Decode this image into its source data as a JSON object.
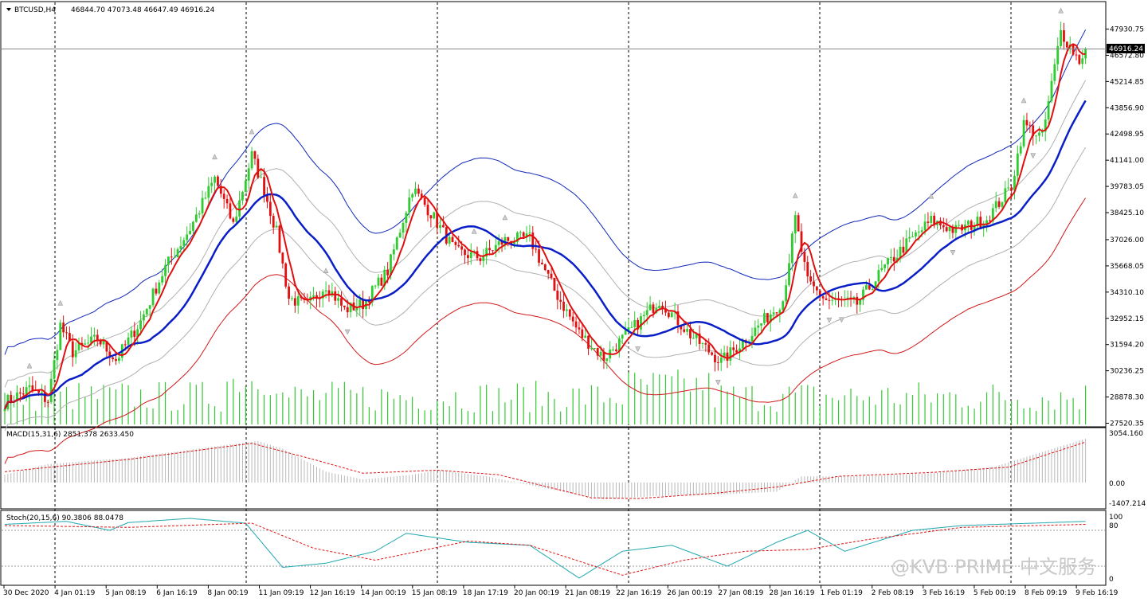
{
  "header": {
    "symbol": "BTCUSD,H4",
    "ohlc": "46844.70 47073.48 46647.49 46916.24"
  },
  "price_scale": {
    "ticks": [
      "47930.75",
      "46572.80",
      "45214.85",
      "43856.90",
      "42498.95",
      "41141.00",
      "39783.05",
      "38425.10",
      "37026.00",
      "35668.05",
      "34310.10",
      "32952.15",
      "31594.20",
      "30236.25",
      "28878.30",
      "27520.35"
    ],
    "current_price": "46916.24"
  },
  "macd": {
    "label": "MACD(15,31,6) 2851.378 2633.450",
    "ticks": [
      "3054.160",
      "0.00",
      "-1407.214"
    ]
  },
  "stoch": {
    "label": "Stoch(20,15,6) 90.3806 88.0478",
    "ticks": [
      "100",
      "80",
      "0"
    ]
  },
  "time_axis": [
    "30 Dec 2020",
    "4 Jan 01:19",
    "5 Jan 08:19",
    "6 Jan 16:19",
    "8 Jan 00:19",
    "11 Jan 09:19",
    "12 Jan 16:19",
    "14 Jan 00:19",
    "15 Jan 08:19",
    "18 Jan 17:19",
    "20 Jan 00:19",
    "21 Jan 08:19",
    "22 Jan 16:19",
    "26 Jan 00:19",
    "27 Jan 08:19",
    "28 Jan 16:19",
    "1 Feb 01:19",
    "2 Feb 08:19",
    "3 Feb 16:19",
    "5 Feb 00:19",
    "8 Feb 09:19",
    "9 Feb 16:19"
  ],
  "watermark": "@KVB PRIME 中文服务",
  "colors": {
    "bull": "#2ecc2e",
    "bear": "#e01010",
    "ema_fast": "#e01010",
    "ema_slow": "#0a1ec8",
    "env_upper": "#1028b8",
    "env_lower": "#d01818",
    "env_inner": "#b0b0b0",
    "volume": "#34c834",
    "stoch_main": "#20a8b0",
    "stoch_signal": "#e01010"
  },
  "chart_data": [
    {
      "type": "candlestick",
      "title": "BTCUSD,H4",
      "ylim": [
        27520.35,
        48800
      ],
      "anchors": [
        [
          0,
          28600
        ],
        [
          8,
          29300
        ],
        [
          14,
          28700
        ],
        [
          18,
          32600
        ],
        [
          22,
          31200
        ],
        [
          30,
          31900
        ],
        [
          36,
          30800
        ],
        [
          44,
          32800
        ],
        [
          52,
          35600
        ],
        [
          60,
          37600
        ],
        [
          68,
          40200
        ],
        [
          74,
          37800
        ],
        [
          80,
          41400
        ],
        [
          84,
          39600
        ],
        [
          88,
          37400
        ],
        [
          92,
          34000
        ],
        [
          98,
          33600
        ],
        [
          104,
          34700
        ],
        [
          110,
          33400
        ],
        [
          116,
          33700
        ],
        [
          124,
          35400
        ],
        [
          132,
          39700
        ],
        [
          138,
          38400
        ],
        [
          146,
          36400
        ],
        [
          154,
          36100
        ],
        [
          162,
          37000
        ],
        [
          170,
          37100
        ],
        [
          178,
          34400
        ],
        [
          186,
          32200
        ],
        [
          194,
          30900
        ],
        [
          202,
          32200
        ],
        [
          212,
          33900
        ],
        [
          222,
          32100
        ],
        [
          232,
          30700
        ],
        [
          242,
          32200
        ],
        [
          252,
          33900
        ],
        [
          256,
          38100
        ],
        [
          260,
          34800
        ],
        [
          266,
          33900
        ],
        [
          276,
          33700
        ],
        [
          284,
          35400
        ],
        [
          292,
          36800
        ],
        [
          300,
          38000
        ],
        [
          308,
          37500
        ],
        [
          318,
          38100
        ],
        [
          326,
          39800
        ],
        [
          330,
          43000
        ],
        [
          336,
          42300
        ],
        [
          342,
          47800
        ],
        [
          348,
          46300
        ],
        [
          350,
          46916
        ]
      ]
    },
    {
      "type": "bar",
      "title": "MACD(15,31,6) 2851.378 2633.450",
      "ylim": [
        -1407.214,
        3054.16
      ],
      "anchors": [
        [
          0,
          500
        ],
        [
          14,
          1200
        ],
        [
          40,
          1600
        ],
        [
          70,
          2400
        ],
        [
          82,
          2700
        ],
        [
          90,
          2200
        ],
        [
          104,
          700
        ],
        [
          116,
          200
        ],
        [
          132,
          500
        ],
        [
          140,
          800
        ],
        [
          156,
          400
        ],
        [
          178,
          -500
        ],
        [
          194,
          -1100
        ],
        [
          210,
          -900
        ],
        [
          230,
          -800
        ],
        [
          250,
          -600
        ],
        [
          258,
          400
        ],
        [
          276,
          400
        ],
        [
          300,
          600
        ],
        [
          320,
          1000
        ],
        [
          350,
          2851
        ]
      ],
      "signal_anchors": [
        [
          0,
          700
        ],
        [
          40,
          1500
        ],
        [
          80,
          2550
        ],
        [
          100,
          1500
        ],
        [
          116,
          600
        ],
        [
          140,
          800
        ],
        [
          160,
          500
        ],
        [
          190,
          -1000
        ],
        [
          205,
          -1050
        ],
        [
          230,
          -700
        ],
        [
          250,
          -300
        ],
        [
          270,
          400
        ],
        [
          300,
          650
        ],
        [
          325,
          1000
        ],
        [
          350,
          2633
        ]
      ]
    },
    {
      "type": "line",
      "title": "Stoch(20,15,6) 90.3806 88.0478",
      "ylim": [
        0,
        100
      ],
      "main_anchors": [
        [
          0,
          90
        ],
        [
          20,
          95
        ],
        [
          34,
          80
        ],
        [
          40,
          93
        ],
        [
          60,
          100
        ],
        [
          78,
          92
        ],
        [
          90,
          18
        ],
        [
          104,
          25
        ],
        [
          120,
          45
        ],
        [
          130,
          75
        ],
        [
          150,
          60
        ],
        [
          170,
          55
        ],
        [
          186,
          0
        ],
        [
          200,
          45
        ],
        [
          216,
          55
        ],
        [
          234,
          20
        ],
        [
          250,
          60
        ],
        [
          260,
          80
        ],
        [
          272,
          45
        ],
        [
          294,
          80
        ],
        [
          310,
          88
        ],
        [
          350,
          95
        ]
      ],
      "signal_anchors": [
        [
          0,
          88
        ],
        [
          40,
          85
        ],
        [
          80,
          92
        ],
        [
          100,
          50
        ],
        [
          120,
          30
        ],
        [
          150,
          62
        ],
        [
          170,
          55
        ],
        [
          200,
          5
        ],
        [
          220,
          30
        ],
        [
          240,
          45
        ],
        [
          260,
          48
        ],
        [
          280,
          65
        ],
        [
          310,
          85
        ],
        [
          350,
          90
        ]
      ]
    }
  ]
}
